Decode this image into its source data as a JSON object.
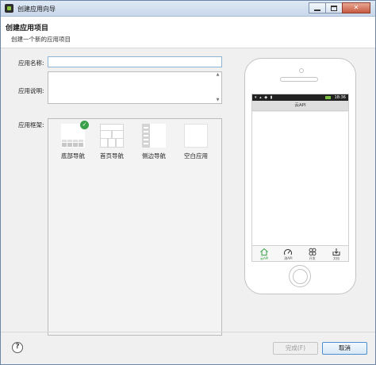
{
  "window": {
    "title": "创建应用向导",
    "controls": {
      "minimize": "minimize-icon",
      "maximize": "maximize-icon",
      "close": "close-icon"
    }
  },
  "header": {
    "title": "创建应用项目",
    "subtitle": "创建一个新的应用项目"
  },
  "form": {
    "name_label": "应用名称:",
    "name_value": "",
    "desc_label": "应用说明:",
    "desc_value": "",
    "framework_label": "应用框架:",
    "frameworks": [
      {
        "label": "底部导航",
        "selected": true,
        "icon": "bottom-nav-template-icon"
      },
      {
        "label": "首页导航",
        "selected": false,
        "icon": "home-nav-template-icon"
      },
      {
        "label": "侧边导航",
        "selected": false,
        "icon": "side-nav-template-icon"
      },
      {
        "label": "空白应用",
        "selected": false,
        "icon": "blank-app-template-icon"
      }
    ]
  },
  "preview": {
    "status_time": "18:36",
    "screen_title": "云API",
    "tabs": [
      {
        "label": "云API",
        "icon": "home-icon",
        "active": true
      },
      {
        "label": "测API",
        "icon": "gauge-icon",
        "active": false
      },
      {
        "label": "开发",
        "icon": "apps-icon",
        "active": false
      },
      {
        "label": "文档",
        "icon": "download-icon",
        "active": false
      }
    ]
  },
  "footer": {
    "help": "?",
    "finish_label": "完成(F)",
    "finish_enabled": false,
    "cancel_label": "取消"
  },
  "colors": {
    "selected_badge": "#3aa04a",
    "active_tab": "#36a146",
    "input_focus_border": "#8fb3d4"
  }
}
